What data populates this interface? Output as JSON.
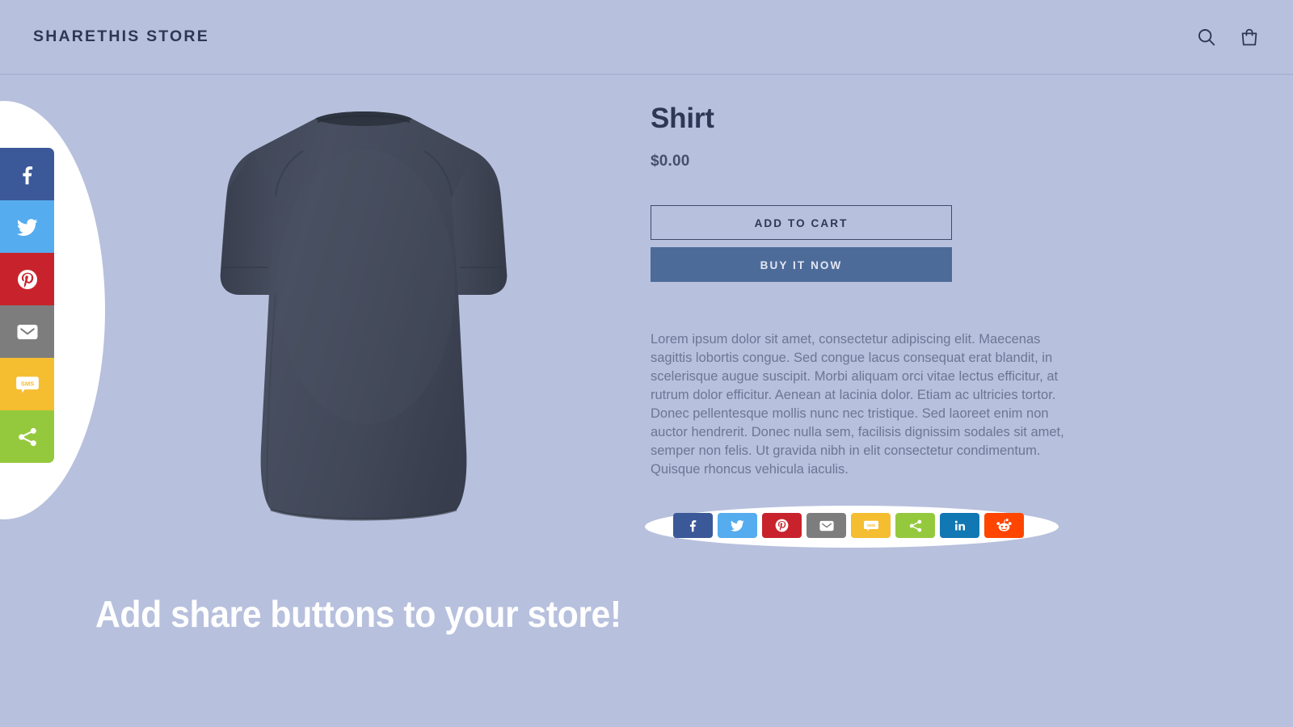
{
  "header": {
    "store_name": "SHARETHIS STORE",
    "actions": [
      {
        "name": "search-icon",
        "label": "Search"
      },
      {
        "name": "cart-icon",
        "label": "Cart"
      }
    ]
  },
  "product": {
    "title": "Shirt",
    "price": "$0.00",
    "image_alt": "Dark gray t-shirt, back view",
    "add_to_cart_label": "Add to cart",
    "buy_it_now_label": "Buy it now",
    "description": "Lorem ipsum dolor sit amet, consectetur adipiscing elit. Maecenas sagittis lobortis congue. Sed congue lacus consequat erat blandit, in scelerisque augue suscipit. Morbi aliquam orci vitae lectus efficitur, at rutrum dolor efficitur. Aenean at lacinia dolor. Etiam ac ultricies tortor. Donec pellentesque mollis nunc nec tristique. Sed laoreet enim non auctor hendrerit. Donec nulla sem, facilisis dignissim sodales sit amet, semper non felis. Ut gravida nibh in elit consectetur condimentum. Quisque rhoncus vehicula iaculis."
  },
  "left_share_rail": {
    "buttons": [
      {
        "network": "facebook",
        "label": "Facebook",
        "color": "#3b5998"
      },
      {
        "network": "twitter",
        "label": "Twitter",
        "color": "#55acee"
      },
      {
        "network": "pinterest",
        "label": "Pinterest",
        "color": "#c8232c"
      },
      {
        "network": "email",
        "label": "Email",
        "color": "#7d7d7d"
      },
      {
        "network": "sms",
        "label": "SMS",
        "color": "#f5bd30"
      },
      {
        "network": "sharethis",
        "label": "Share",
        "color": "#95c93d"
      }
    ]
  },
  "inline_share_row": {
    "buttons": [
      {
        "network": "facebook",
        "label": "Facebook",
        "color": "#3b5998"
      },
      {
        "network": "twitter",
        "label": "Twitter",
        "color": "#55acee"
      },
      {
        "network": "pinterest",
        "label": "Pinterest",
        "color": "#c8232c"
      },
      {
        "network": "email",
        "label": "Email",
        "color": "#7d7d7d"
      },
      {
        "network": "sms",
        "label": "SMS",
        "color": "#f5bd30"
      },
      {
        "network": "sharethis",
        "label": "Share",
        "color": "#95c93d"
      },
      {
        "network": "linkedin",
        "label": "LinkedIn",
        "color": "#1278b3"
      },
      {
        "network": "reddit",
        "label": "Reddit",
        "color": "#ff4500"
      }
    ]
  },
  "promo": {
    "headline": "Add share buttons to your store!"
  },
  "colors": {
    "page_background": "#b7c0dd",
    "header_border": "#aab5d6",
    "text_dark": "#2e3855",
    "text_muted": "#6c7794",
    "buy_button": "#4d6b99",
    "shirt": "#434b5c",
    "white": "#ffffff"
  }
}
